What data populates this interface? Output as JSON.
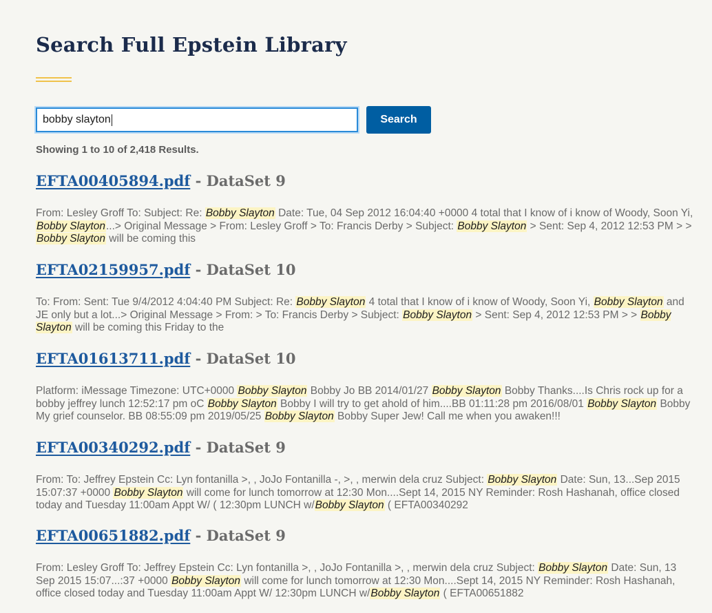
{
  "page_title": "Search Full Epstein Library",
  "search": {
    "value": "bobby slayton",
    "button_label": "Search"
  },
  "results_count_text": "Showing 1 to 10 of 2,418 Results.",
  "results": [
    {
      "filename": "EFTA00405894.pdf",
      "separator": " - ",
      "dataset": "DataSet 9",
      "snippet": [
        {
          "t": "From: Lesley Groff To: Subject: Re: "
        },
        {
          "h": "Bobby Slayton"
        },
        {
          "t": " Date: Tue, 04 Sep 2012 16:04:40 +0000 4 total that I know of i know of Woody, Soon Yi, "
        },
        {
          "h": "Bobby Slayton"
        },
        {
          "t": "...> Original Message > From: Lesley Groff > To: Francis Derby > Subject: "
        },
        {
          "h": "Bobby Slayton"
        },
        {
          "t": " > Sent: Sep 4, 2012 12:53 PM > > "
        },
        {
          "h": "Bobby Slayton"
        },
        {
          "t": " will be coming this"
        }
      ]
    },
    {
      "filename": "EFTA02159957.pdf",
      "separator": " - ",
      "dataset": "DataSet 10",
      "snippet": [
        {
          "t": "To: From: Sent: Tue 9/4/2012 4:04:40 PM Subject: Re: "
        },
        {
          "h": "Bobby Slayton"
        },
        {
          "t": " 4 total that I know of i know of Woody, Soon Yi, "
        },
        {
          "h": "Bobby Slayton"
        },
        {
          "t": " and JE only but a lot...> Original Message > From: > To: Francis Derby > Subject: "
        },
        {
          "h": "Bobby Slayton"
        },
        {
          "t": " > Sent: Sep 4, 2012 12:53 PM > > "
        },
        {
          "h": "Bobby Slayton"
        },
        {
          "t": " will be coming this Friday to the"
        }
      ]
    },
    {
      "filename": "EFTA01613711.pdf",
      "separator": " - ",
      "dataset": "DataSet 10",
      "snippet": [
        {
          "t": "Platform: iMessage Timezone: UTC+0000 "
        },
        {
          "h": "Bobby Slayton"
        },
        {
          "t": " Bobby Jo BB 2014/01/27 "
        },
        {
          "h": "Bobby Slayton"
        },
        {
          "t": " Bobby Thanks....Is Chris rock up for a bobby jeffrey lunch 12:52:17 pm oC "
        },
        {
          "h": "Bobby Slayton"
        },
        {
          "t": " Bobby I will try to get ahold of him....BB 01:11:28 pm 2016/08/01 "
        },
        {
          "h": "Bobby Slayton"
        },
        {
          "t": " Bobby My grief counselor. BB 08:55:09 pm 2019/05/25 "
        },
        {
          "h": "Bobby Slayton"
        },
        {
          "t": " Bobby Super Jew! Call me when you awaken!!!"
        }
      ]
    },
    {
      "filename": "EFTA00340292.pdf",
      "separator": " - ",
      "dataset": "DataSet 9",
      "snippet": [
        {
          "t": "From: To: Jeffrey Epstein Cc: Lyn fontanilla >, , JoJo Fontanilla -, >, , merwin dela cruz Subject: "
        },
        {
          "h": "Bobby Slayton"
        },
        {
          "t": " Date: Sun, 13...Sep 2015 15:07:37 +0000 "
        },
        {
          "h": "Bobby Slayton"
        },
        {
          "t": " will come for lunch tomorrow at 12:30 Mon....Sept 14, 2015 NY Reminder: Rosh Hashanah, office closed today and Tuesday 11:00am Appt W/ ( 12:30pm LUNCH w/"
        },
        {
          "h": "Bobby Slayton"
        },
        {
          "t": " ( EFTA00340292"
        }
      ]
    },
    {
      "filename": "EFTA00651882.pdf",
      "separator": " - ",
      "dataset": "DataSet 9",
      "snippet": [
        {
          "t": "From: Lesley Groff To: Jeffrey Epstein Cc: Lyn fontanilla >, , JoJo Fontanilla >, , merwin dela cruz Subject: "
        },
        {
          "h": "Bobby Slayton"
        },
        {
          "t": " Date: Sun, 13 Sep 2015 15:07...:37 +0000 "
        },
        {
          "h": "Bobby Slayton"
        },
        {
          "t": " will come for lunch tomorrow at 12:30 Mon....Sept 14, 2015 NY Reminder: Rosh Hashanah, office closed today and Tuesday 11:00am Appt W/ 12:30pm LUNCH w/"
        },
        {
          "h": "Bobby Slayton"
        },
        {
          "t": " ( EFTA00651882"
        }
      ]
    }
  ]
}
